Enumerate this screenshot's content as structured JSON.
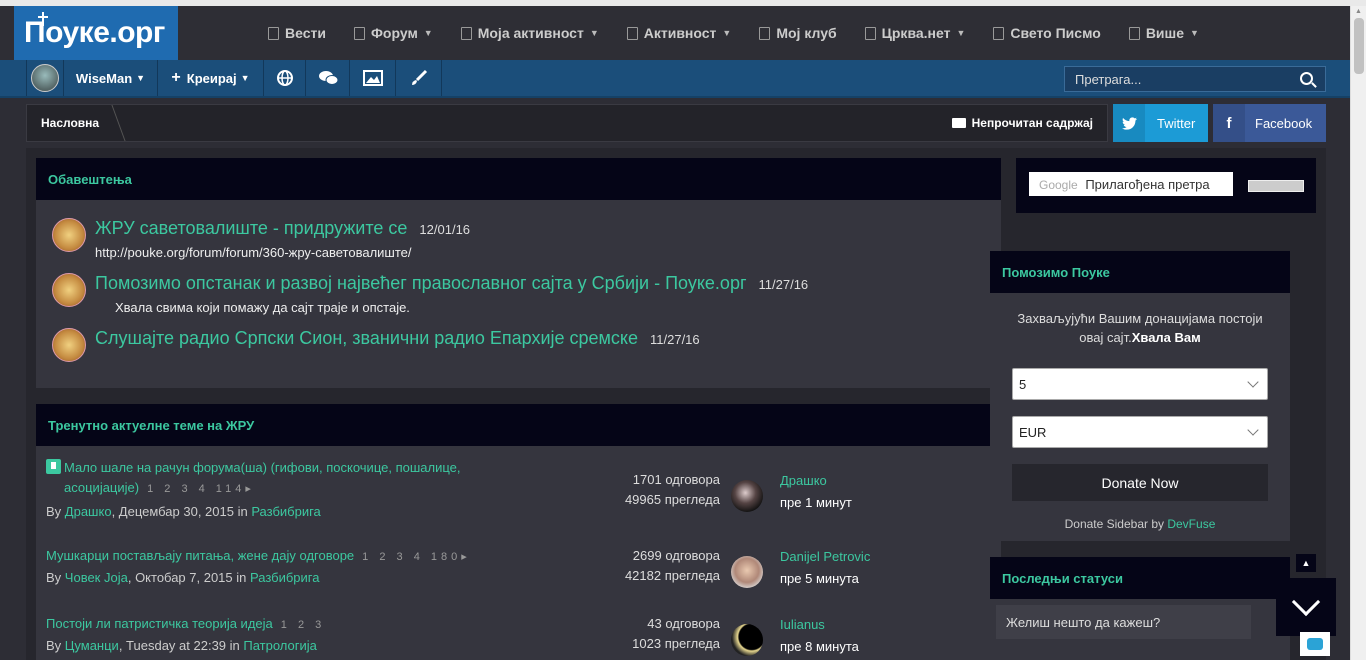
{
  "header": {
    "logo_text": "Поуке.орг",
    "nav": [
      {
        "label": "Вести",
        "caret": false
      },
      {
        "label": "Форум",
        "caret": true
      },
      {
        "label": "Моја активност",
        "caret": true
      },
      {
        "label": "Активност",
        "caret": true
      },
      {
        "label": "Мој клуб",
        "caret": false
      },
      {
        "label": "Црква.нет",
        "caret": true
      },
      {
        "label": "Свето Писмо",
        "caret": false
      },
      {
        "label": "Више",
        "caret": true
      }
    ]
  },
  "subbar": {
    "username": "WiseMan",
    "create": "Креирај",
    "search_placeholder": "Претрага..."
  },
  "breadcrumb": {
    "home": "Насловна",
    "unread": "Непрочитан садржај"
  },
  "social": {
    "twitter": "Twitter",
    "facebook": "Facebook"
  },
  "announcements": {
    "title": "Обавештења",
    "items": [
      {
        "title": "ЖРУ саветовалиште - придружите се",
        "date": "12/01/16",
        "sub": "http://pouke.org/forum/forum/360-жру-саветовалиште/"
      },
      {
        "title": "Помозимо опстанак и развој највећег православног сајта у Србији - Поуке.орг",
        "date": "11/27/16",
        "sub": "Хвала свима који помажу да сајт траје и опстаје."
      },
      {
        "title": "Слушајте радио Српски Сион, званични радио Епархије сремске",
        "date": "11/27/16",
        "sub": ""
      }
    ]
  },
  "topics": {
    "title": "Тренутно актуелне теме на ЖРУ",
    "items": [
      {
        "title_line1": "Мало шале на рачун форума(ша) (гифови, поскочице, пошалице,",
        "title_line2": "асоцијације)",
        "pages": "1 2 3 4 114▸",
        "by": "By",
        "author": "Драшко",
        "date_in": ", Децембар 30, 2015 in ",
        "forum": "Разбибрига",
        "replies": "1701 одговора",
        "views": "49965 прегледа",
        "last_user": "Драшко",
        "last_time": "пре 1 минут"
      },
      {
        "title_line1": "Мушкарци постављају питања, жене дају одговоре",
        "title_line2": "",
        "pages": "1 2 3 4 180▸",
        "by": "By",
        "author": "Човек Јоја",
        "date_in": ", Октобар 7, 2015 in ",
        "forum": "Разбибрига",
        "replies": "2699 одговора",
        "views": "42182 прегледа",
        "last_user": "Danijel Petrovic",
        "last_time": "пре 5 минута"
      },
      {
        "title_line1": "Постоји ли патристичка теорија идеја",
        "title_line2": "",
        "pages": "1 2 3",
        "by": "By",
        "author": "Цуманци",
        "date_in": ", Tuesday at 22:39 in ",
        "forum": "Патрологија",
        "replies": "43 одговора",
        "views": "1023 прегледа",
        "last_user": "Iulianus",
        "last_time": "пре 8 минута"
      }
    ]
  },
  "sidebar": {
    "google_label": "Google",
    "google_placeholder": "Прилагођена претра",
    "donate_title": "Помозимо Поуке",
    "donate_text1": "Захваљујући Вашим донацијама постоји",
    "donate_text2": "овај сајт.",
    "donate_bold": "Хвала Вам",
    "amount": "5",
    "currency": "EUR",
    "donate_button": "Donate Now",
    "credit": "Donate Sidebar by ",
    "credit_link": "DevFuse",
    "status_title": "Последњи статуси",
    "status_placeholder": "Желиш нешто да кажеш?"
  },
  "colors": {
    "accent": "#3cc8a0",
    "header_bg": "#2e2e35",
    "bar_bg": "#1b4e7a",
    "twitter": "#1c9bd6",
    "facebook": "#3b5998"
  }
}
